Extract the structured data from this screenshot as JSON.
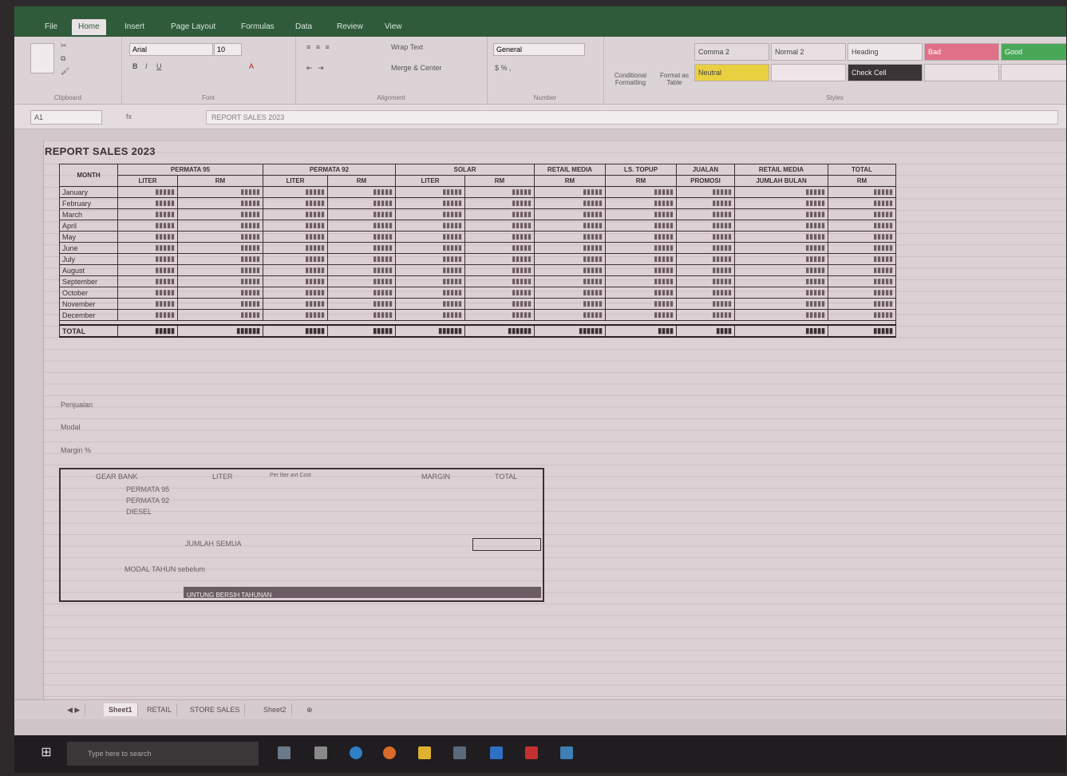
{
  "tabs": [
    "File",
    "Home",
    "Insert",
    "Page Layout",
    "Formulas",
    "Data",
    "Review",
    "View"
  ],
  "active_tab": "Home",
  "ribbon": {
    "clipboard_label": "Clipboard",
    "font_label": "Font",
    "alignment_label": "Alignment",
    "number_label": "Number",
    "styles_label": "Styles",
    "font_name": "Arial",
    "font_size": "10",
    "wrap_text": "Wrap Text",
    "merge_center": "Merge & Center",
    "number_format": "General",
    "conditional_formatting": "Conditional Formatting",
    "format_as_table": "Format as Table",
    "styles": [
      "Comma 2",
      "Normal 2",
      "Heading",
      "Bad",
      "Good",
      "Neutral",
      "Check Cell"
    ]
  },
  "formula_bar": {
    "name_box": "A1",
    "fx": "fx",
    "formula": "REPORT SALES 2023"
  },
  "report": {
    "title": "REPORT SALES 2023",
    "headers_top": [
      "MONTH",
      "PERMATA 95",
      "PERMATA 92",
      "SOLAR",
      "RETAIL MEDIA",
      "LS. TOPUP",
      "JUALAN",
      "RETAIL MEDIA",
      "TOTAL"
    ],
    "headers_sub": [
      "",
      "LITER",
      "RM",
      "LITER",
      "RM",
      "LITER",
      "RM",
      "RM",
      "RM",
      "PROMOSI",
      "JUMLAH BULAN",
      "RM"
    ],
    "months": [
      "January",
      "February",
      "March",
      "April",
      "May",
      "June",
      "July",
      "August",
      "September",
      "October",
      "November",
      "December"
    ],
    "total_label": "TOTAL"
  },
  "summary": {
    "rows": [
      "Penjualan",
      "Modal",
      "Margin %"
    ]
  },
  "box": {
    "heading_left": "GEAR BANK",
    "col_liter": "LITER",
    "col_note": "Per liter avt Cost",
    "col_margin": "MARGIN",
    "col_total": "TOTAL",
    "items": [
      "PERMATA 95",
      "PERMATA 92",
      "DIESEL"
    ],
    "subtotal_label": "JUMLAH SEMUA",
    "extra_label": "MODAL TAHUN sebelum",
    "final_label": "UNTUNG BERSIH TAHUNAN"
  },
  "sheet_tabs": [
    "Sheet1",
    "RETAIL",
    "STORE SALES",
    "Sheet2"
  ],
  "taskbar": {
    "search": "Type here to search"
  },
  "colors": {
    "tab_green": "#2f5b3a",
    "style_bad": "#e07088",
    "style_neutral": "#e8d040",
    "style_good": "#49a857",
    "style_heading": "#3b3436"
  }
}
